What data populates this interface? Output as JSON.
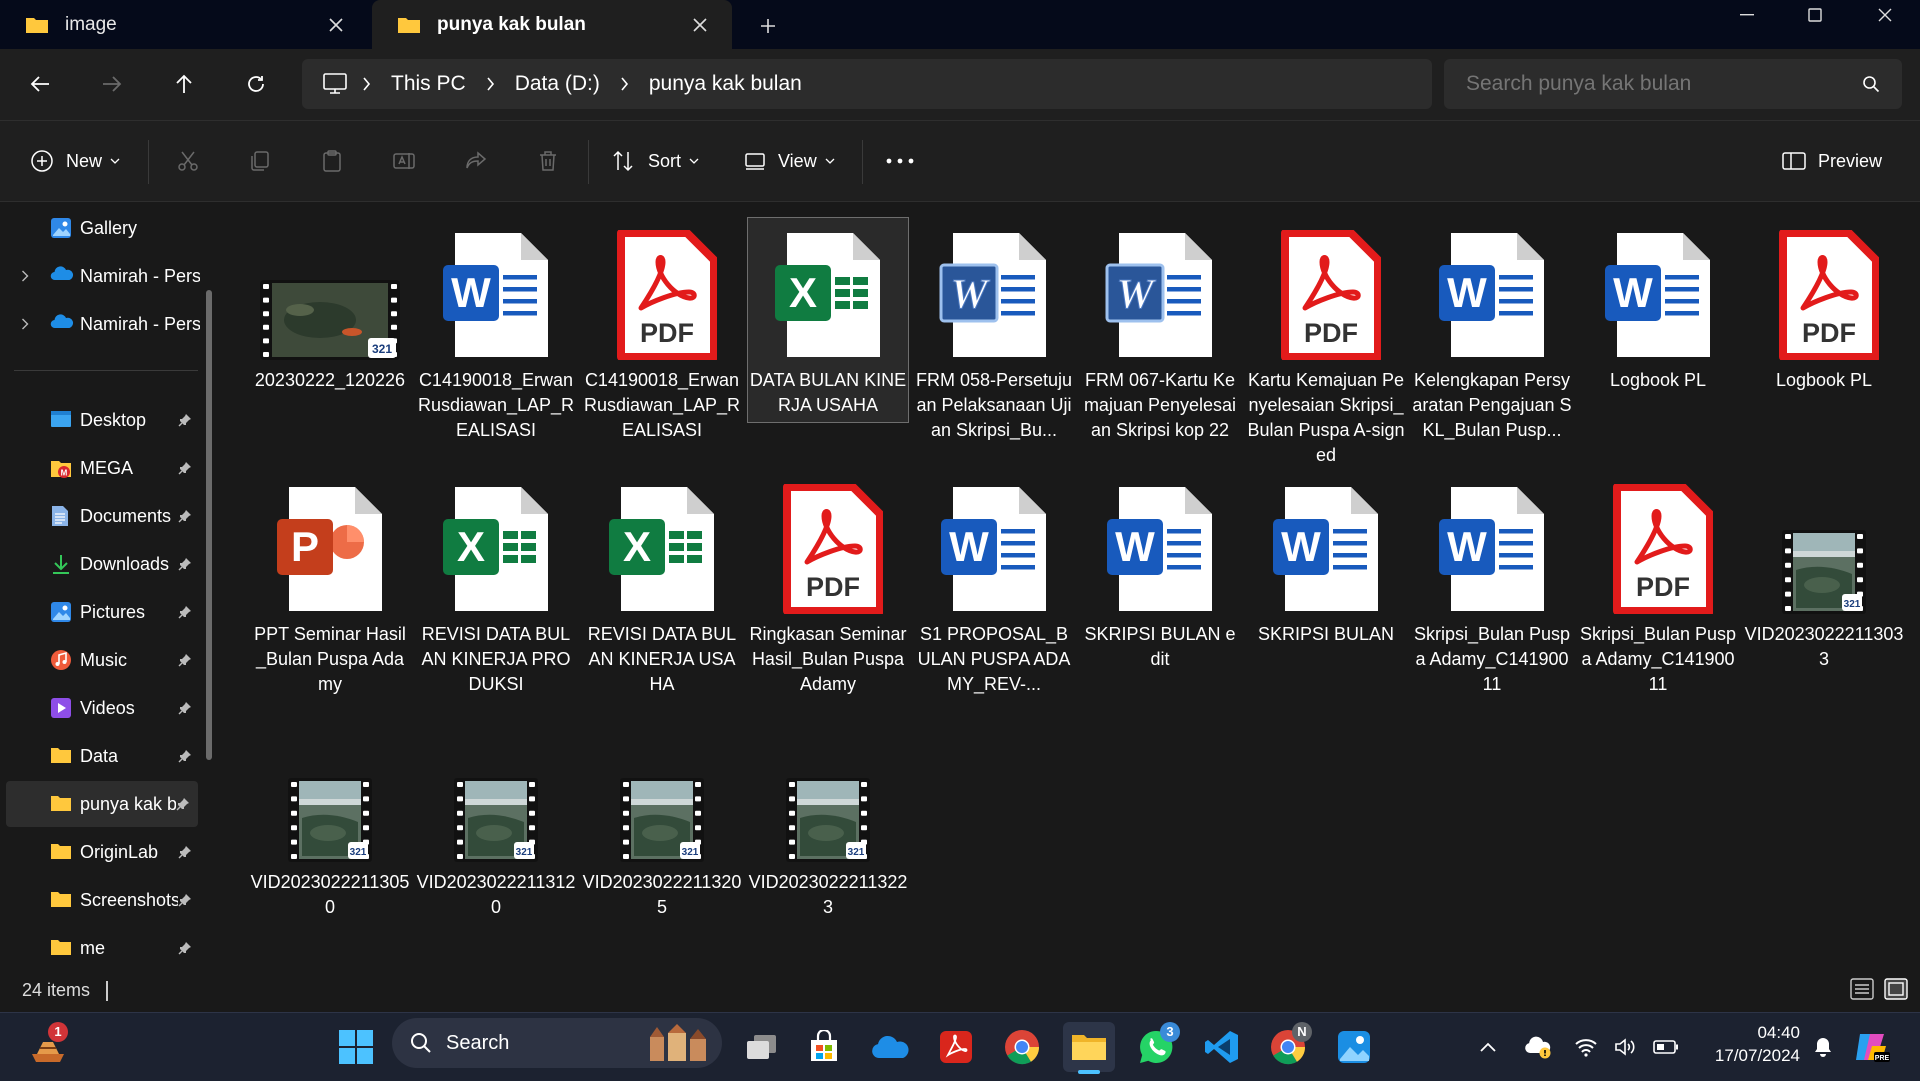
{
  "tabs": [
    {
      "label": "image",
      "active": false
    },
    {
      "label": "punya kak bulan",
      "active": true
    }
  ],
  "window_controls": [
    "minimize-icon",
    "maximize-icon",
    "close-icon"
  ],
  "breadcrumb": [
    "This PC",
    "Data (D:)",
    "punya kak bulan"
  ],
  "search": {
    "placeholder": "Search punya kak bulan"
  },
  "commands": {
    "new": "New",
    "sort": "Sort",
    "view": "View",
    "preview": "Preview"
  },
  "sidebar": {
    "top": [
      {
        "label": "Gallery",
        "icon": "gallery-icon",
        "expandable": false
      },
      {
        "label": "Namirah - Pers",
        "icon": "onedrive-icon",
        "expandable": true
      },
      {
        "label": "Namirah - Pers",
        "icon": "onedrive-icon",
        "expandable": true
      }
    ],
    "quick_access": [
      {
        "label": "Desktop",
        "icon": "desktop-icon"
      },
      {
        "label": "MEGA",
        "icon": "mega-icon"
      },
      {
        "label": "Documents",
        "icon": "documents-icon"
      },
      {
        "label": "Downloads",
        "icon": "downloads-icon"
      },
      {
        "label": "Pictures",
        "icon": "pictures-icon"
      },
      {
        "label": "Music",
        "icon": "music-icon"
      },
      {
        "label": "Videos",
        "icon": "videos-icon"
      },
      {
        "label": "Data",
        "icon": "folder-icon"
      },
      {
        "label": "punya kak bulan",
        "icon": "folder-icon",
        "selected": true
      },
      {
        "label": "OriginLab",
        "icon": "folder-icon"
      },
      {
        "label": "Screenshots",
        "icon": "folder-icon"
      },
      {
        "label": "me",
        "icon": "folder-icon"
      }
    ]
  },
  "files": [
    {
      "name": "20230222_120226",
      "type": "video"
    },
    {
      "name": "C14190018_Erwan Rusdiawan_LAP_REALISASI",
      "type": "word"
    },
    {
      "name": "C14190018_Erwan Rusdiawan_LAP_REALISASI",
      "type": "pdf"
    },
    {
      "name": "DATA BULAN KINERJA USAHA",
      "type": "excel",
      "selected": true
    },
    {
      "name": "FRM 058-Persetujuan Pelaksanaan Ujian Skripsi_Bu...",
      "type": "word-old"
    },
    {
      "name": "FRM 067-Kartu Kemajuan Penyelesaian Skripsi kop 22",
      "type": "word-old"
    },
    {
      "name": "Kartu Kemajuan Penyelesaian Skripsi_Bulan Puspa A-signed",
      "type": "pdf"
    },
    {
      "name": "Kelengkapan Persyaratan Pengajuan SKL_Bulan Pusp...",
      "type": "word"
    },
    {
      "name": "Logbook PL",
      "type": "word"
    },
    {
      "name": "Logbook PL",
      "type": "pdf"
    },
    {
      "name": "PPT Seminar Hasil_Bulan Puspa Adamy",
      "type": "ppt"
    },
    {
      "name": "REVISI DATA BULAN KINERJA PRODUKSI",
      "type": "excel"
    },
    {
      "name": "REVISI DATA BULAN KINERJA USAHA",
      "type": "excel"
    },
    {
      "name": "Ringkasan Seminar Hasil_Bulan Puspa Adamy",
      "type": "pdf"
    },
    {
      "name": "S1 PROPOSAL_BULAN PUSPA ADAMY_REV-...",
      "type": "word"
    },
    {
      "name": "SKRIPSI BULAN edit",
      "type": "word"
    },
    {
      "name": "SKRIPSI BULAN",
      "type": "word"
    },
    {
      "name": "Skripsi_Bulan Puspa Adamy_C14190011",
      "type": "word"
    },
    {
      "name": "Skripsi_Bulan Puspa Adamy_C14190011",
      "type": "pdf"
    },
    {
      "name": "VID20230222113033",
      "type": "video-small"
    },
    {
      "name": "VID20230222113050",
      "type": "video-small"
    },
    {
      "name": "VID20230222113120",
      "type": "video-small"
    },
    {
      "name": "VID20230222113205",
      "type": "video-small"
    },
    {
      "name": "VID20230222113223",
      "type": "video-small"
    }
  ],
  "status": {
    "items": "24 items"
  },
  "taskbar": {
    "search_label": "Search",
    "clock_time": "04:40",
    "clock_date": "17/07/2024",
    "widget_badge": "1",
    "whatsapp_badge": "3",
    "chrome_badge": "N"
  },
  "colors": {
    "accent": "#4cc2ff",
    "word": "#185abd",
    "excel": "#107c41",
    "pdf": "#e21b1b",
    "ppt": "#c43e1c",
    "folder": "#ffc83d"
  }
}
